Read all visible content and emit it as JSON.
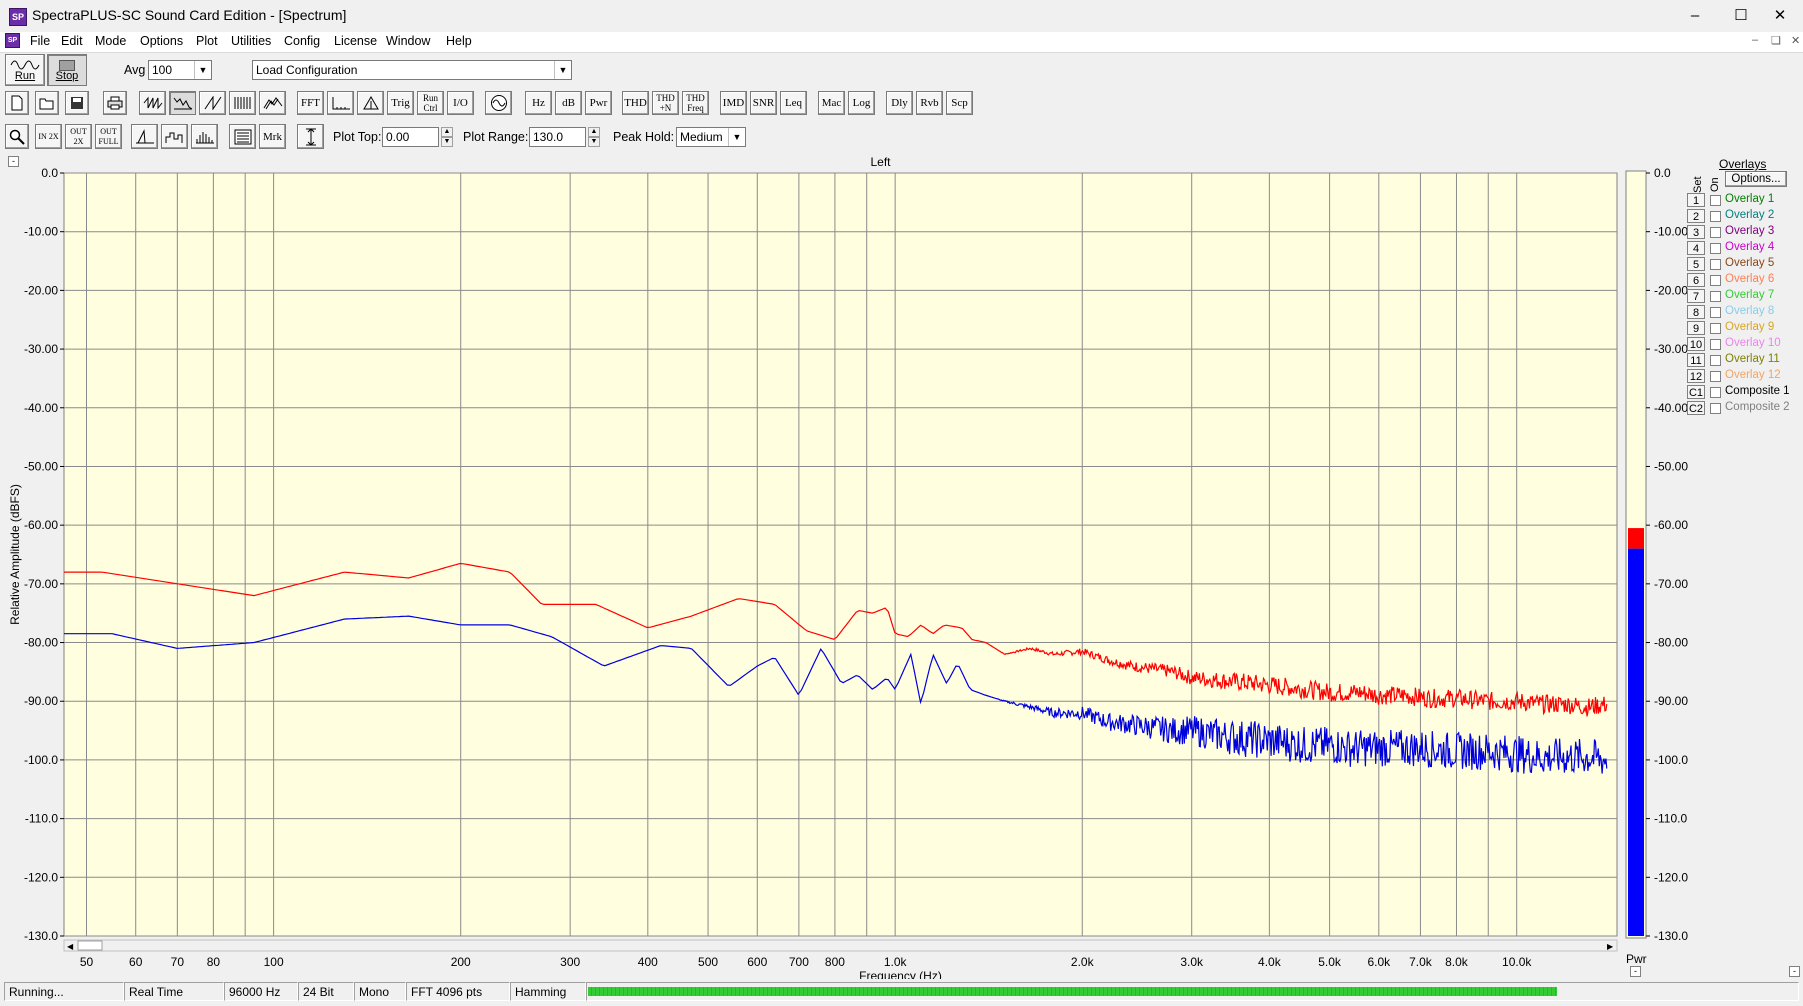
{
  "window": {
    "title": "SpectraPLUS-SC Sound Card Edition - [Spectrum]",
    "app_icon_text": "SP"
  },
  "menu": [
    "File",
    "Edit",
    "Mode",
    "Options",
    "Plot",
    "Utilities",
    "Config",
    "License",
    "Window",
    "Help"
  ],
  "toolbar1": {
    "run_label": "Run",
    "stop_label": "Stop",
    "avg_label": "Avg",
    "avg_value": "100",
    "config_value": "Load Configuration"
  },
  "toolbar2": [
    "FFT",
    "Trig",
    "Run Ctrl",
    "I/O",
    "Hz",
    "dB",
    "Pwr",
    "THD",
    "THD +N",
    "THD Freq",
    "IMD",
    "SNR",
    "Leq",
    "Mac",
    "Log",
    "Dly",
    "Rvb",
    "Scp"
  ],
  "toolbar3": {
    "mrk_label": "Mrk",
    "plot_top_label": "Plot Top:",
    "plot_top_value": "0.00",
    "plot_range_label": "Plot Range:",
    "plot_range_value": "130.0",
    "peak_hold_label": "Peak Hold:",
    "peak_hold_value": "Medium",
    "zoom_in": "IN 2X",
    "zoom_out": "OUT 2X",
    "zoom_full": "OUT FULL"
  },
  "plot": {
    "channel_title": "Left",
    "plot_bg": "#ffffe0",
    "meter_label": "Pwr"
  },
  "overlays": {
    "title": "Overlays",
    "set_label": "Set",
    "on_label": "On",
    "options_label": "Options...",
    "items": [
      {
        "num": "1",
        "name": "Overlay 1",
        "color": "#008000"
      },
      {
        "num": "2",
        "name": "Overlay 2",
        "color": "#008080"
      },
      {
        "num": "3",
        "name": "Overlay 3",
        "color": "#800080"
      },
      {
        "num": "4",
        "name": "Overlay 4",
        "color": "#cc00cc"
      },
      {
        "num": "5",
        "name": "Overlay 5",
        "color": "#8b4513"
      },
      {
        "num": "6",
        "name": "Overlay 6",
        "color": "#ff7f50"
      },
      {
        "num": "7",
        "name": "Overlay 7",
        "color": "#32cd32"
      },
      {
        "num": "8",
        "name": "Overlay 8",
        "color": "#87ceeb"
      },
      {
        "num": "9",
        "name": "Overlay 9",
        "color": "#daa520"
      },
      {
        "num": "10",
        "name": "Overlay 10",
        "color": "#ee82ee"
      },
      {
        "num": "11",
        "name": "Overlay 11",
        "color": "#808000"
      },
      {
        "num": "12",
        "name": "Overlay 12",
        "color": "#f4a460"
      },
      {
        "num": "C1",
        "name": "Composite 1",
        "color": "#000000"
      },
      {
        "num": "C2",
        "name": "Composite 2",
        "color": "#808080"
      }
    ]
  },
  "status": {
    "state": "Running...",
    "mode": "Real Time",
    "rate": "96000 Hz",
    "bits": "24 Bit",
    "channels": "Mono",
    "fft": "FFT 4096 pts",
    "window": "Hamming",
    "progress": 0.8
  },
  "colors": {
    "red_trace": "#ff0000",
    "blue_trace": "#0000dd",
    "meter_red": "#ff0000",
    "meter_blue": "#0000ff",
    "progress_green": "#33cc33"
  },
  "chart_data": {
    "type": "line",
    "title": "Left",
    "xlabel": "Frequency (Hz)",
    "ylabel": "Relative Amplitude (dBFS)",
    "xscale": "log",
    "xlim": [
      46,
      14500
    ],
    "ylim": [
      -130,
      0
    ],
    "grid": true,
    "x_ticks": [
      50,
      60,
      70,
      80,
      100,
      200,
      300,
      400,
      500,
      600,
      700,
      800,
      1000,
      2000,
      3000,
      4000,
      5000,
      6000,
      7000,
      8000,
      10000
    ],
    "x_tick_labels": [
      "50",
      "60",
      "70",
      "80",
      "100",
      "200",
      "300",
      "400",
      "500",
      "600",
      "700",
      "800",
      "1.0k",
      "2.0k",
      "3.0k",
      "4.0k",
      "5.0k",
      "6.0k",
      "7.0k",
      "8.0k",
      "10.0k"
    ],
    "y_ticks": [
      0,
      -10,
      -20,
      -30,
      -40,
      -50,
      -60,
      -70,
      -80,
      -90,
      -100,
      -110,
      -120,
      -130
    ],
    "y_tick_labels": [
      "0.0",
      "-10.00",
      "-20.00",
      "-30.00",
      "-40.00",
      "-50.00",
      "-60.00",
      "-70.00",
      "-80.00",
      "-90.00",
      "-100.0",
      "-110.0",
      "-120.0",
      "-130.0"
    ],
    "meter": {
      "label": "Pwr",
      "peak_db": -60.5,
      "level_db": -64
    },
    "series": [
      {
        "color": "#ff0000",
        "points": [
          [
            46,
            -68
          ],
          [
            53,
            -68
          ],
          [
            70,
            -70
          ],
          [
            93,
            -72
          ],
          [
            130,
            -68
          ],
          [
            165,
            -69
          ],
          [
            200,
            -66.5
          ],
          [
            240,
            -68
          ],
          [
            270,
            -73.5
          ],
          [
            330,
            -73.5
          ],
          [
            400,
            -77.5
          ],
          [
            470,
            -75.5
          ],
          [
            560,
            -72.5
          ],
          [
            640,
            -73.5
          ],
          [
            720,
            -78
          ],
          [
            800,
            -79.5
          ],
          [
            870,
            -74.5
          ],
          [
            920,
            -75
          ],
          [
            970,
            -74
          ],
          [
            1000,
            -78.5
          ],
          [
            1050,
            -79
          ],
          [
            1100,
            -77
          ],
          [
            1150,
            -78.5
          ],
          [
            1200,
            -77
          ],
          [
            1280,
            -77.5
          ],
          [
            1330,
            -79.5
          ],
          [
            1400,
            -80
          ],
          [
            1500,
            -82
          ],
          [
            1650,
            -81
          ],
          [
            1800,
            -82
          ],
          [
            2000,
            -81.5
          ],
          [
            2200,
            -83
          ],
          [
            2400,
            -84
          ],
          [
            2600,
            -84.5
          ],
          [
            2800,
            -85
          ],
          [
            3000,
            -86
          ],
          [
            3400,
            -86.5
          ],
          [
            3800,
            -87
          ],
          [
            4200,
            -87.5
          ],
          [
            4600,
            -88
          ],
          [
            5000,
            -88.5
          ],
          [
            5300,
            -88.5
          ],
          [
            5600,
            -88.5
          ],
          [
            6000,
            -89
          ],
          [
            6600,
            -89
          ],
          [
            7200,
            -89.5
          ],
          [
            8000,
            -89.5
          ],
          [
            9000,
            -90
          ],
          [
            10000,
            -90
          ],
          [
            11000,
            -90.5
          ],
          [
            12000,
            -90.5
          ],
          [
            13000,
            -91
          ],
          [
            14000,
            -90.5
          ]
        ]
      },
      {
        "color": "#0000dd",
        "points": [
          [
            46,
            -78.5
          ],
          [
            55,
            -78.5
          ],
          [
            70,
            -81
          ],
          [
            93,
            -80
          ],
          [
            130,
            -76
          ],
          [
            165,
            -75.5
          ],
          [
            200,
            -77
          ],
          [
            240,
            -77
          ],
          [
            280,
            -79
          ],
          [
            340,
            -84
          ],
          [
            420,
            -80.5
          ],
          [
            470,
            -81
          ],
          [
            540,
            -87.5
          ],
          [
            600,
            -84
          ],
          [
            640,
            -82.5
          ],
          [
            700,
            -89
          ],
          [
            760,
            -81
          ],
          [
            820,
            -87
          ],
          [
            870,
            -85.5
          ],
          [
            920,
            -88
          ],
          [
            970,
            -86
          ],
          [
            1000,
            -88
          ],
          [
            1060,
            -82
          ],
          [
            1100,
            -90.5
          ],
          [
            1150,
            -82
          ],
          [
            1210,
            -87
          ],
          [
            1260,
            -83.5
          ],
          [
            1320,
            -88
          ],
          [
            1400,
            -89
          ],
          [
            1500,
            -90
          ],
          [
            1650,
            -91
          ],
          [
            1800,
            -92
          ],
          [
            2000,
            -92
          ],
          [
            2200,
            -93.5
          ],
          [
            2400,
            -94
          ],
          [
            2600,
            -94.5
          ],
          [
            2800,
            -95
          ],
          [
            3000,
            -95
          ],
          [
            3400,
            -96
          ],
          [
            3800,
            -96.5
          ],
          [
            4200,
            -97
          ],
          [
            4600,
            -97.5
          ],
          [
            5000,
            -97.5
          ],
          [
            5400,
            -98
          ],
          [
            5800,
            -98
          ],
          [
            6400,
            -98
          ],
          [
            7000,
            -98
          ],
          [
            8000,
            -98.5
          ],
          [
            9000,
            -98.5
          ],
          [
            10000,
            -99
          ],
          [
            11000,
            -99.5
          ],
          [
            12000,
            -99.5
          ],
          [
            13000,
            -99.5
          ],
          [
            14000,
            -100
          ]
        ]
      }
    ]
  }
}
